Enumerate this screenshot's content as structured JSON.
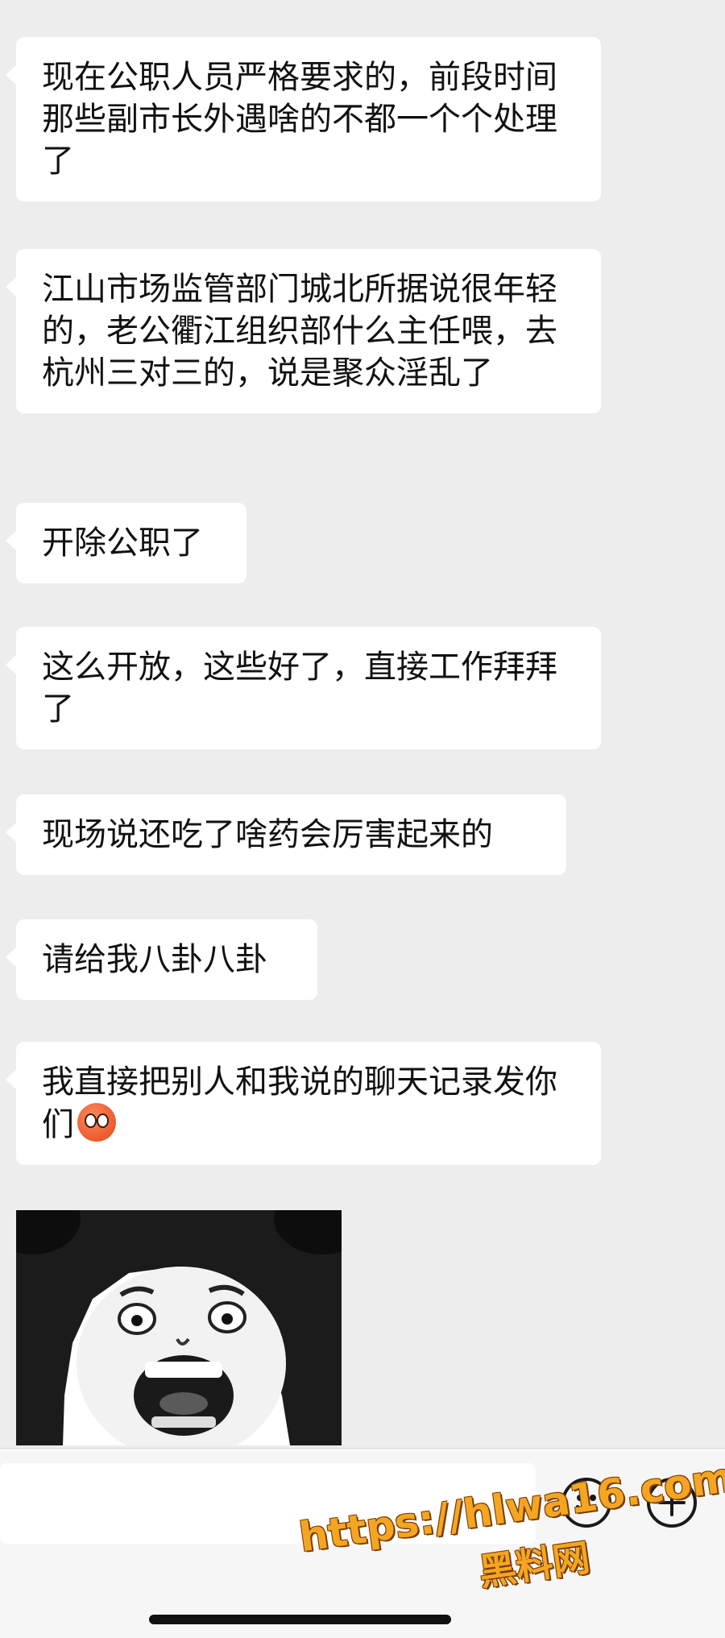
{
  "messages": [
    {
      "text": "现在公职人员严格要求的，前段时间那些副市长外遇啥的不都一个个处理了"
    },
    {
      "text": "江山市场监管部门城北所据说很年轻的，老公衢江组织部什么主任喂，去杭州三对三的，说是聚众淫乱了"
    },
    {
      "text": "开除公职了"
    },
    {
      "text": "这么开放，这些好了，直接工作拜拜了"
    },
    {
      "text": "现场说还吃了啥药会厉害起来的"
    },
    {
      "text": "请给我八卦八卦"
    },
    {
      "text": "我直接把别人和我说的聊天记录发你们",
      "emoji": "hot-face-emoji"
    }
  ],
  "sticker": {
    "icon": "panda-face-meme"
  },
  "input_bar": {
    "message_input": {
      "placeholder": "",
      "value": ""
    },
    "emoji_button": {
      "icon": "smiley-icon"
    },
    "more_button": {
      "icon": "plus-icon"
    }
  },
  "watermark": {
    "line1": "https://hlwa16.com",
    "line2": "黑料网",
    "color": "#f4a623"
  }
}
